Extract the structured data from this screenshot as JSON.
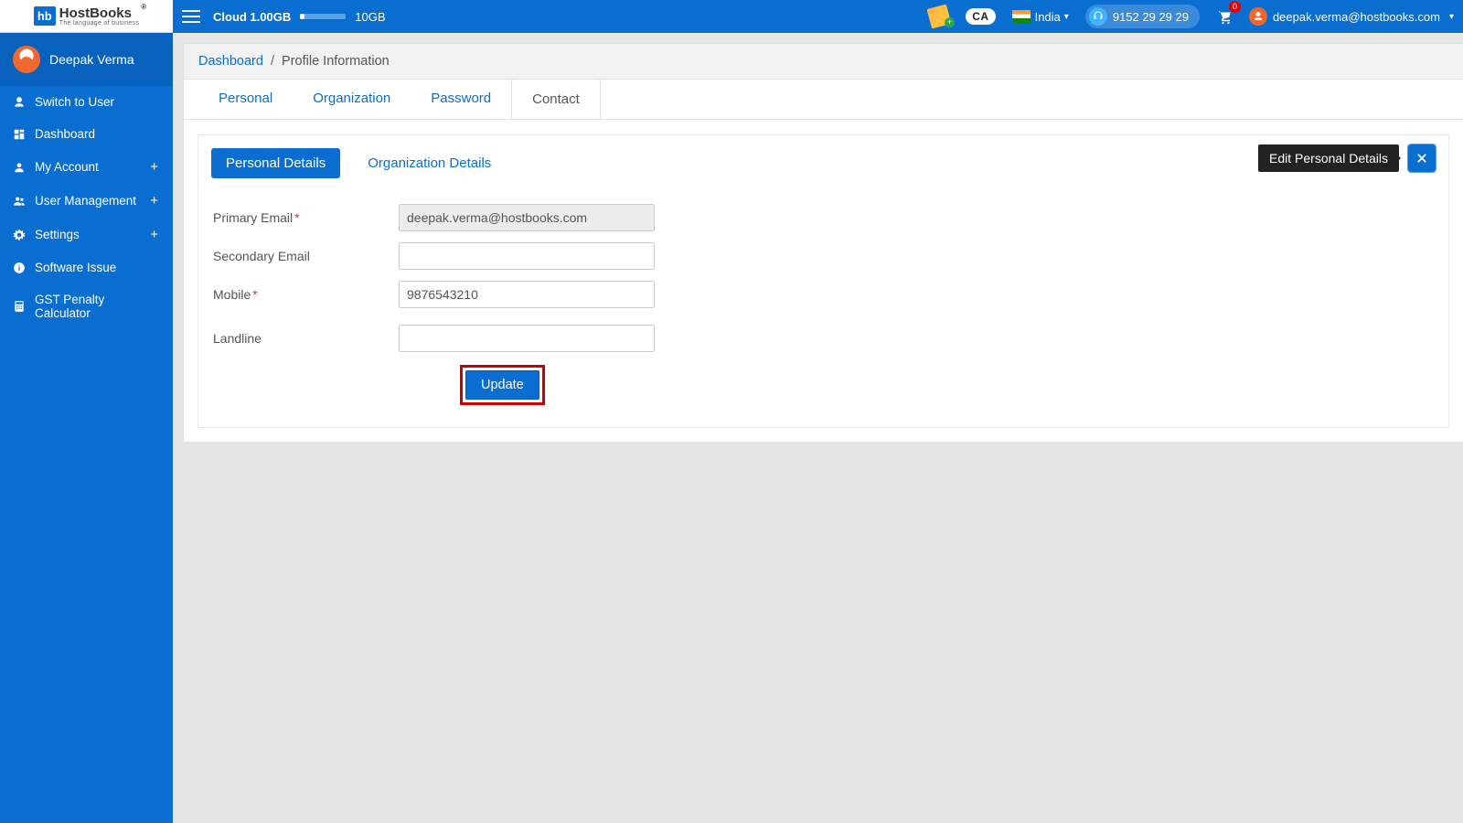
{
  "logo": {
    "badge": "hb",
    "name": "HostBooks",
    "tagline": "The language of business",
    "reg": "®"
  },
  "topbar": {
    "cloud_label": "Cloud 1.00GB",
    "storage_max": "10GB",
    "country": "India",
    "support_phone": "9152 29 29 29",
    "cart_count": "0",
    "user_email": "deepak.verma@hostbooks.com",
    "ca_label": "CA"
  },
  "sidebar": {
    "user_name": "Deepak Verma",
    "items": [
      {
        "label": "Switch to User",
        "icon": "user",
        "expandable": false
      },
      {
        "label": "Dashboard",
        "icon": "dashboard",
        "expandable": false
      },
      {
        "label": "My Account",
        "icon": "account",
        "expandable": true
      },
      {
        "label": "User Management",
        "icon": "users",
        "expandable": true
      },
      {
        "label": "Settings",
        "icon": "gear",
        "expandable": true
      },
      {
        "label": "Software Issue",
        "icon": "info",
        "expandable": false
      },
      {
        "label": "GST Penalty Calculator",
        "icon": "calculator",
        "expandable": false
      }
    ]
  },
  "breadcrumb": {
    "link": "Dashboard",
    "sep": "/",
    "current": "Profile Information"
  },
  "tabs": [
    "Personal",
    "Organization",
    "Password",
    "Contact"
  ],
  "subtabs": [
    "Personal Details",
    "Organization Details"
  ],
  "tooltip": "Edit Personal Details",
  "form": {
    "primary_email": {
      "label": "Primary Email",
      "value": "deepak.verma@hostbooks.com",
      "required": true,
      "disabled": true
    },
    "secondary_email": {
      "label": "Secondary Email",
      "value": "",
      "required": false,
      "disabled": false
    },
    "mobile": {
      "label": "Mobile",
      "value": "9876543210",
      "required": true,
      "disabled": false
    },
    "landline": {
      "label": "Landline",
      "value": "",
      "required": false,
      "disabled": false
    },
    "update_label": "Update"
  }
}
